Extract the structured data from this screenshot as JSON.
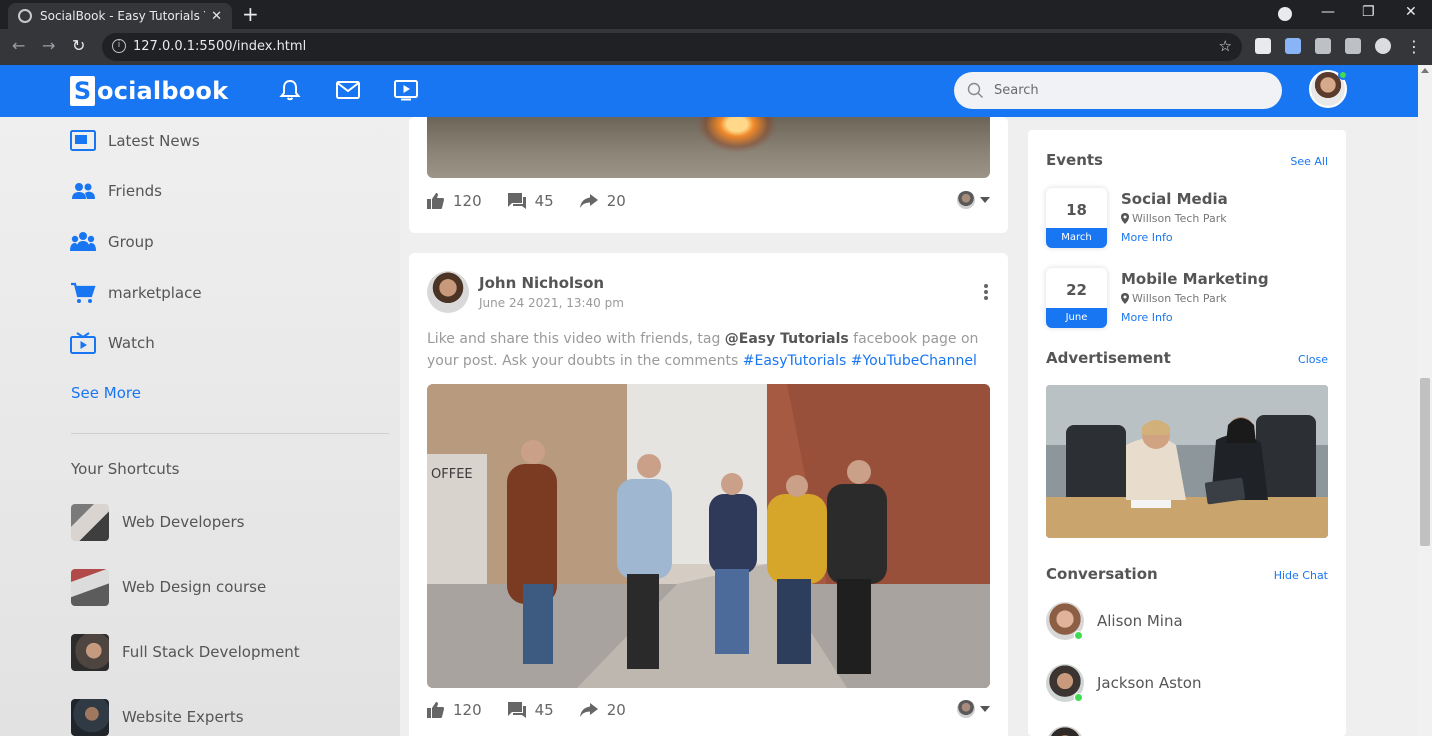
{
  "browser": {
    "tab_title": "SocialBook - Easy Tutorials YouTu",
    "url": "127.0.0.1:5500/index.html"
  },
  "header": {
    "logo_letter": "S",
    "logo_text": "ocialbook",
    "search_placeholder": "Search",
    "accent_color": "#1876f2"
  },
  "sidebar": {
    "links": [
      {
        "label": "Latest News",
        "icon": "news-icon"
      },
      {
        "label": "Friends",
        "icon": "friends-icon"
      },
      {
        "label": "Group",
        "icon": "group-icon"
      },
      {
        "label": "marketplace",
        "icon": "cart-icon"
      },
      {
        "label": "Watch",
        "icon": "watch-icon"
      }
    ],
    "see_more": "See More",
    "shortcuts_title": "Your Shortcuts",
    "shortcuts": [
      {
        "label": "Web Developers"
      },
      {
        "label": "Web Design course"
      },
      {
        "label": "Full Stack Development"
      },
      {
        "label": "Website Experts"
      }
    ]
  },
  "feed": {
    "post1": {
      "likes": "120",
      "comments": "45",
      "shares": "20"
    },
    "post2": {
      "author": "John Nicholson",
      "date": "June 24 2021, 13:40 pm",
      "text_before": "Like and share this video with friends, tag ",
      "tag": "@Easy Tutorials",
      "text_after": " facebook page on your post. Ask your doubts in the comments ",
      "hashtag1": "#EasyTutorials",
      "hashtag2": "#YouTubeChannel",
      "likes": "120",
      "comments": "45",
      "shares": "20"
    }
  },
  "right": {
    "events_title": "Events",
    "see_all": "See All",
    "events": [
      {
        "day": "18",
        "month": "March",
        "title": "Social Media",
        "place": "Willson Tech Park",
        "more": "More Info"
      },
      {
        "day": "22",
        "month": "June",
        "title": "Mobile Marketing",
        "place": "Willson Tech Park",
        "more": "More Info"
      }
    ],
    "ad_title": "Advertisement",
    "ad_close": "Close",
    "conversation_title": "Conversation",
    "hide_chat": "Hide Chat",
    "contacts": [
      {
        "name": "Alison Mina"
      },
      {
        "name": "Jackson Aston"
      }
    ]
  }
}
